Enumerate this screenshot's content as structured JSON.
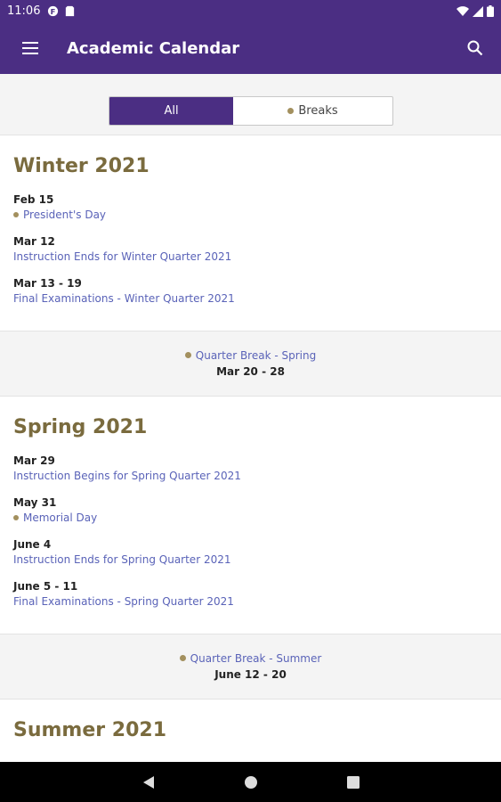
{
  "status_bar": {
    "time": "11:06"
  },
  "app_bar": {
    "title": "Academic Calendar"
  },
  "filter": {
    "all_label": "All",
    "breaks_label": "Breaks"
  },
  "terms": [
    {
      "title": "Winter 2021",
      "events": [
        {
          "date": "Feb 15",
          "name": "President's Day",
          "is_break": true
        },
        {
          "date": "Mar 12",
          "name": "Instruction Ends for Winter Quarter 2021",
          "is_break": false
        },
        {
          "date": "Mar 13 - 19",
          "name": "Final Examinations - Winter Quarter 2021",
          "is_break": false
        }
      ]
    },
    {
      "title": "Spring 2021",
      "events": [
        {
          "date": "Mar 29",
          "name": "Instruction Begins for Spring Quarter 2021",
          "is_break": false
        },
        {
          "date": "May 31",
          "name": "Memorial Day",
          "is_break": true
        },
        {
          "date": "June 4",
          "name": "Instruction Ends for Spring Quarter 2021",
          "is_break": false
        },
        {
          "date": "June 5 - 11",
          "name": "Final Examinations - Spring Quarter 2021",
          "is_break": false
        }
      ]
    },
    {
      "title": "Summer 2021",
      "events": []
    }
  ],
  "breaks": [
    {
      "name": "Quarter Break - Spring",
      "date": "Mar 20 - 28"
    },
    {
      "name": "Quarter Break - Summer",
      "date": "June 12 - 20"
    }
  ],
  "colors": {
    "brand_purple": "#4b2e83",
    "gold": "#a3905e",
    "link_blue": "#5a63b8"
  }
}
